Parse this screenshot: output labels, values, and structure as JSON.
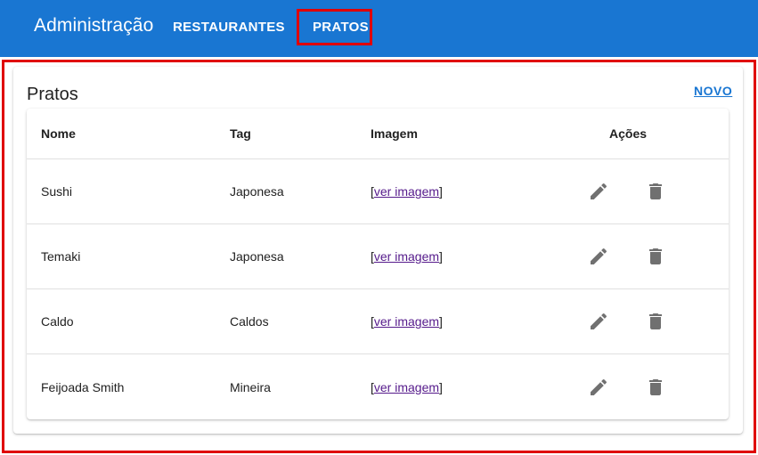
{
  "appbar": {
    "title": "Administração",
    "nav": [
      {
        "label": "RESTAURANTES"
      },
      {
        "label": "PRATOS",
        "highlighted": true
      }
    ]
  },
  "page": {
    "title": "Pratos",
    "new_link": "NOVO"
  },
  "table": {
    "headers": {
      "nome": "Nome",
      "tag": "Tag",
      "imagem": "Imagem",
      "acoes": "Ações"
    },
    "rows": [
      {
        "nome": "Sushi",
        "tag": "Japonesa",
        "bracket_open": "[",
        "link": "ver imagem",
        "bracket_close": "]"
      },
      {
        "nome": "Temaki",
        "tag": "Japonesa",
        "bracket_open": "[",
        "link": "ver imagem",
        "bracket_close": "]"
      },
      {
        "nome": "Caldo",
        "tag": "Caldos",
        "bracket_open": "[",
        "link": "ver imagem",
        "bracket_close": "]"
      },
      {
        "nome": "Feijoada Smith",
        "tag": "Mineira",
        "bracket_open": "[",
        "link": "ver imagem",
        "bracket_close": "]"
      }
    ],
    "row_actions": [
      "edit-icon",
      "delete-icon"
    ]
  },
  "colors": {
    "appbar": "#1976d2",
    "highlight": "#e00000",
    "link": "#1976d2",
    "visited_link": "#551a8b",
    "icon": "#707070"
  }
}
